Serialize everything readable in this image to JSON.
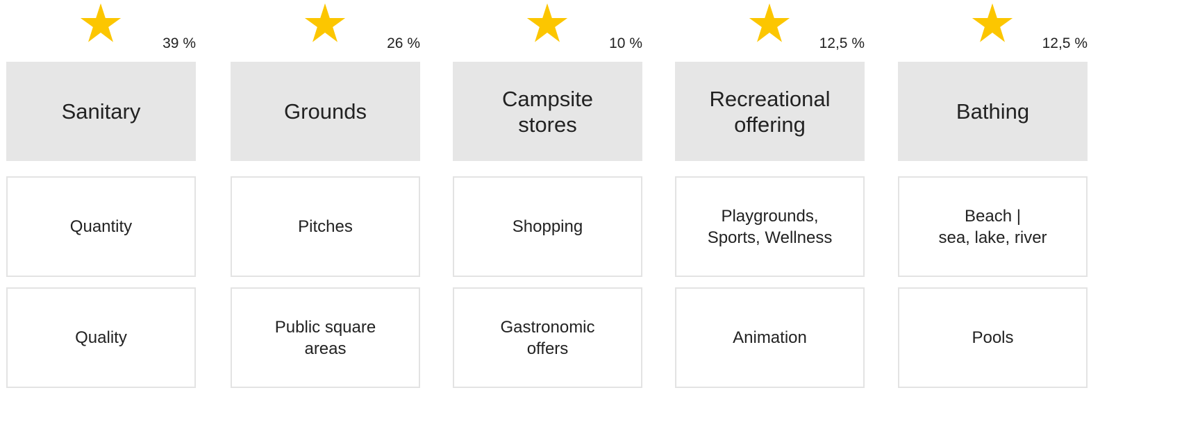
{
  "star_icon": "star-icon",
  "star_color": "#fcc600",
  "header_bg": "#e6e6e6",
  "border_color": "#e3e3e3",
  "categories": [
    {
      "percent": "39 %",
      "label": "Sanitary",
      "items": [
        "Quantity",
        "Quality"
      ]
    },
    {
      "percent": "26 %",
      "label": "Grounds",
      "items": [
        "Pitches",
        "Public square\nareas"
      ]
    },
    {
      "percent": "10 %",
      "label": "Campsite\nstores",
      "items": [
        "Shopping",
        "Gastronomic\noffers"
      ]
    },
    {
      "percent": "12,5 %",
      "label": "Recreational\noffering",
      "items": [
        "Playgrounds,\nSports, Wellness",
        "Animation"
      ]
    },
    {
      "percent": "12,5 %",
      "label": "Bathing",
      "items": [
        "Beach |\nsea, lake, river",
        "Pools"
      ]
    }
  ]
}
